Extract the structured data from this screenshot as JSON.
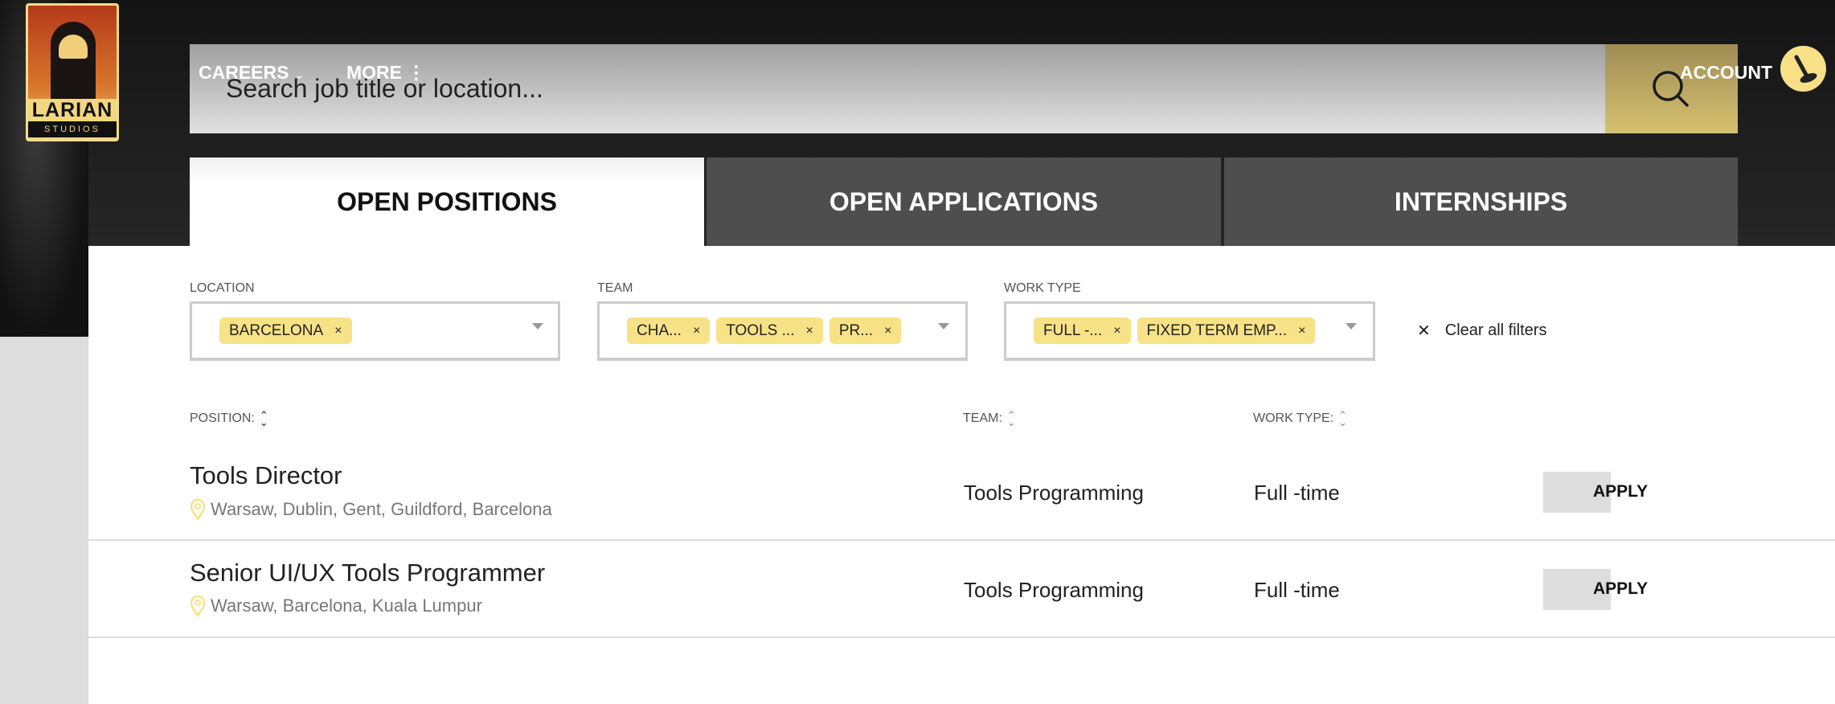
{
  "brand": {
    "logo_text": "LARIAN",
    "logo_subtext": "STUDIOS"
  },
  "nav": {
    "careers": "CAREERS",
    "more": "MORE",
    "account": "ACCOUNT"
  },
  "search": {
    "placeholder": "Search job title or location..."
  },
  "tabs": [
    {
      "label": "OPEN POSITIONS",
      "active": true
    },
    {
      "label": "OPEN APPLICATIONS"
    },
    {
      "label": "INTERNSHIPS"
    }
  ],
  "filters": {
    "location": {
      "label": "LOCATION",
      "chips": [
        "BARCELONA"
      ]
    },
    "team": {
      "label": "TEAM",
      "chips": [
        "CHA...",
        "TOOLS ...",
        "PR..."
      ]
    },
    "work_type": {
      "label": "WORK TYPE",
      "chips": [
        "FULL -...",
        "FIXED TERM EMP..."
      ]
    },
    "clear_all": "Clear all filters",
    "chip_remove": "×",
    "clear_icon": "✕"
  },
  "columns": {
    "position": "POSITION:",
    "team": "TEAM:",
    "work_type": "WORK TYPE:"
  },
  "jobs": [
    {
      "title": "Tools Director",
      "locations": "Warsaw, Dublin, Gent, Guildford, Barcelona",
      "team": "Tools Programming",
      "work_type": "Full -time",
      "apply": "APPLY"
    },
    {
      "title": "Senior UI/UX Tools Programmer",
      "locations": "Warsaw, Barcelona, Kuala Lumpur",
      "team": "Tools Programming",
      "work_type": "Full -time",
      "apply": "APPLY"
    }
  ],
  "colors": {
    "accent": "#f8e287",
    "header": "#1c1c1c",
    "tab_inactive": "#4e4e4e"
  }
}
